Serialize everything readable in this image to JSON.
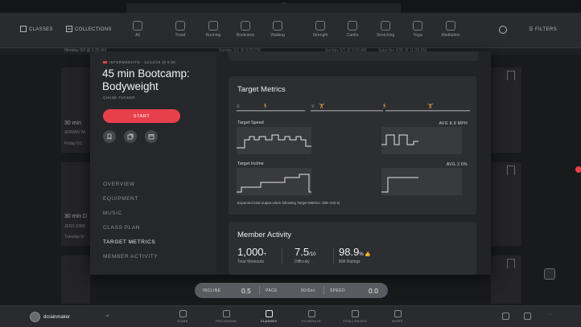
{
  "status_bar": {
    "title": "Classes"
  },
  "top_nav": {
    "classes_label": "CLASSES",
    "collections_label": "COLLECTIONS",
    "categories": [
      "All",
      "Tread",
      "Running",
      "Bootcamp",
      "Walking",
      "Strength",
      "Cardio",
      "Stretching",
      "Yoga",
      "Meditation"
    ],
    "filters_label": "FILTERS"
  },
  "background": {
    "top_dates": [
      "Monday 5/2 @ 6:30 AM",
      "Sunday 5/1 @ 9:00 PM",
      "Sunday 5/1 @ 9:00 AM",
      "Saturday 4/30 @ 11:00 AM"
    ],
    "card1_title": "30 min",
    "card1_instructor": "ADRIAN WI",
    "card1_date": "Friday 5/1",
    "card2_title": "30 min D",
    "card2_instructor": "JESS SIMS",
    "card2_date": "Tuesday 5/"
  },
  "class": {
    "level": "INTERMEDIATE · 11/12/19 @ 6:30",
    "title": "45 min Bootcamp: Bodyweight",
    "instructor": "CHASE TUCKER",
    "start_label": "START"
  },
  "sections": [
    "OVERVIEW",
    "EQUIPMENT",
    "MUSIC",
    "CLASS PLAN",
    "TARGET METRICS",
    "MEMBER ACTIVITY"
  ],
  "target_metrics": {
    "heading": "Target Metrics",
    "speed_label": "Target Speed",
    "speed_avg": "AVG 8.9 MPH",
    "speed_max": "14",
    "speed_min": "1",
    "incline_label": "Target Incline",
    "incline_avg": "AVG 2.6%",
    "incline_max": "4",
    "incline_min": "0",
    "footnote": "Expected total output when following Target Metrics: 286–432 kj"
  },
  "member_activity": {
    "heading": "Member Activity",
    "total_workouts": "1,000",
    "total_workouts_suffix": "+",
    "total_workouts_label": "Total Workouts",
    "difficulty": "7.5",
    "difficulty_suffix": "/10",
    "difficulty_label": "Difficulty",
    "rating": "98.9",
    "rating_suffix": "%",
    "rating_label": "808 Ratings"
  },
  "metrics_bar": {
    "incline_label": "INCLINE",
    "incline_value": "0.5",
    "pace_label": "PACE",
    "pace_value": "00/Sec",
    "speed_label": "SPEED",
    "speed_value": "0.0"
  },
  "bottom_nav": {
    "username": "dcrainmaker",
    "items": [
      "HOME",
      "PROGRAMS",
      "CLASSES",
      "SCHEDULE",
      "CHALLENGES",
      "MORE"
    ]
  },
  "colors": {
    "accent": "#e8404a",
    "modal_bg": "#26272b",
    "panel_bg": "#2d2e32"
  }
}
